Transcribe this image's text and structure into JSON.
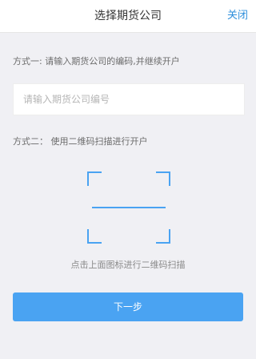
{
  "header": {
    "title": "选择期货公司",
    "close_label": "关闭"
  },
  "method1": {
    "text": "方式一: 请输入期货公司的编码,并继续开户",
    "input_placeholder": "请输入期货公司编号",
    "input_value": ""
  },
  "method2": {
    "text": "方式二： 使用二维码扫描进行开户",
    "scan_hint": "点击上面图标进行二维码扫描"
  },
  "actions": {
    "next_label": "下一步"
  },
  "colors": {
    "accent": "#4aa3f2",
    "link": "#2f8fdc",
    "background": "#f0f0f4"
  },
  "icons": {
    "scanner": "qr-scan-frame-icon"
  }
}
